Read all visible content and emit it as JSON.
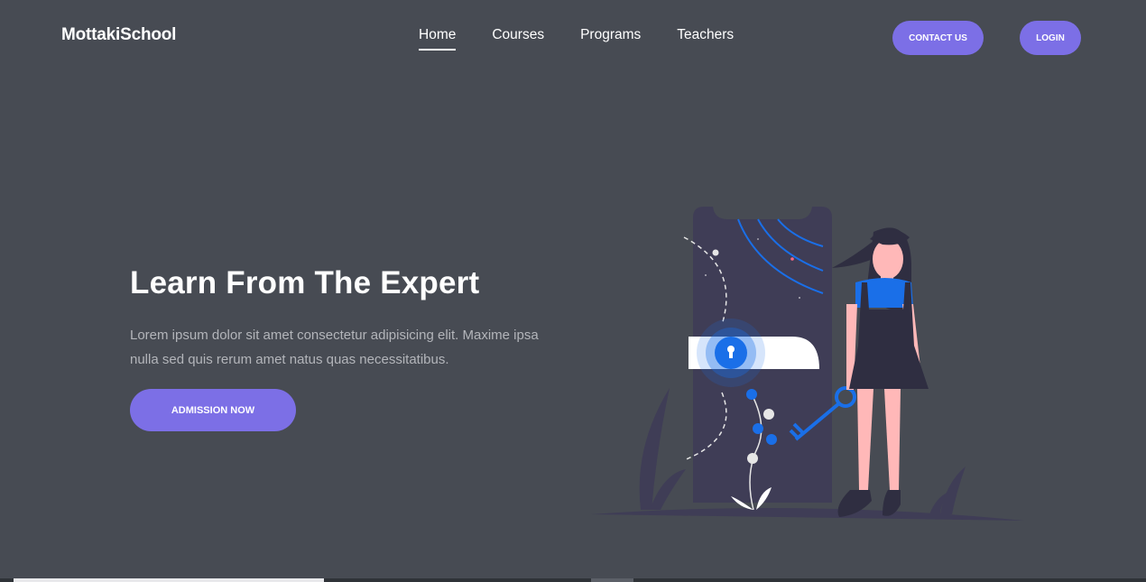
{
  "brand": {
    "logo": "MottakiSchool"
  },
  "nav": {
    "items": [
      {
        "label": "Home",
        "active": true
      },
      {
        "label": "Courses"
      },
      {
        "label": "Programs"
      },
      {
        "label": "Teachers"
      }
    ]
  },
  "header": {
    "contact_label": "CONTACT US",
    "login_label": "LOGIN"
  },
  "hero": {
    "title": "Learn From The Expert",
    "text": "Lorem ipsum dolor sit amet consectetur adipisicing elit. Maxime ipsa nulla sed quis rerum amet natus quas necessitatibus.",
    "cta_label": "ADMISSION NOW"
  },
  "colors": {
    "background": "#474b53",
    "accent": "#7c6fe6",
    "illustration_blue": "#1a6fe8",
    "phone": "#3f3d56"
  },
  "icons": [
    "keyhole-icon",
    "key-icon"
  ]
}
